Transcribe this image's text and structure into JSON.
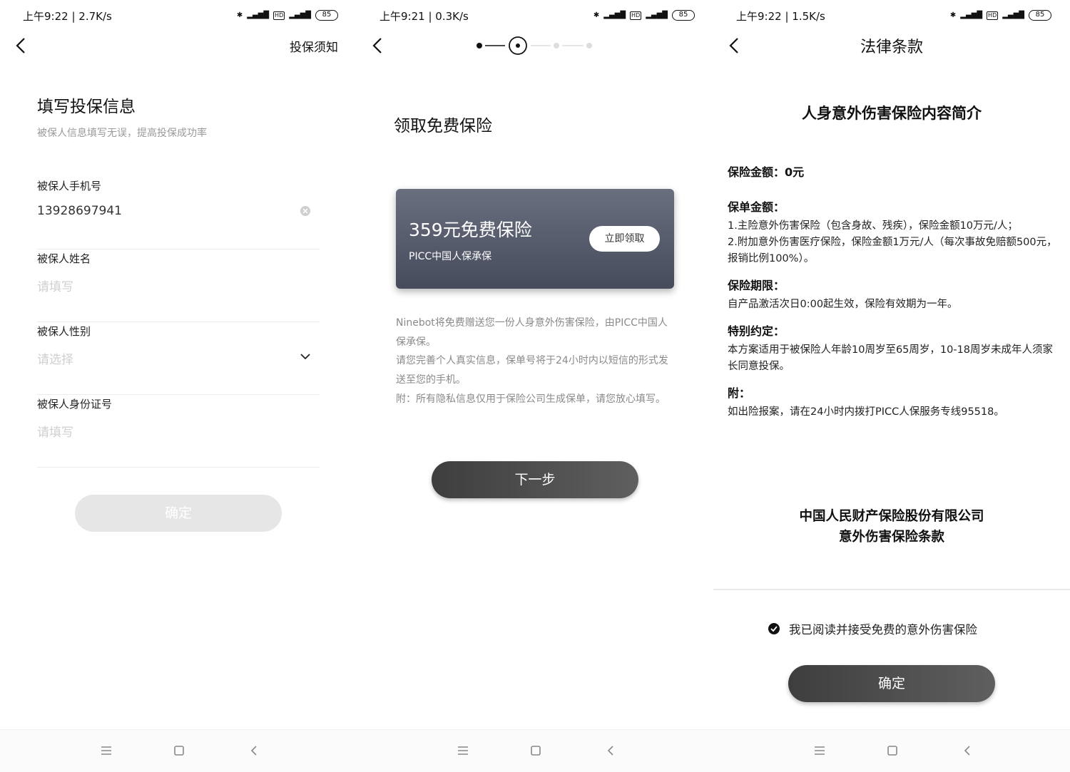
{
  "screen1": {
    "status": {
      "time": "上午9:22 | 2.7K/s",
      "battery": "85"
    },
    "notice_link": "投保须知",
    "title": "填写投保信息",
    "subtitle": "被保人信息填写无误，提高投保成功率",
    "fields": [
      {
        "label": "被保人手机号",
        "value": "13928697941"
      },
      {
        "label": "被保人姓名",
        "placeholder": "请填写"
      },
      {
        "label": "被保人性别",
        "placeholder": "请选择"
      },
      {
        "label": "被保人身份证号",
        "placeholder": "请填写"
      }
    ],
    "confirm": "确定"
  },
  "screen2": {
    "status": {
      "time": "上午9:21 | 0.3K/s",
      "battery": "85"
    },
    "title": "领取免费保险",
    "card": {
      "title": "359元免费保险",
      "subtitle": "PICC中国人保承保",
      "button": "立即领取"
    },
    "desc": [
      "Ninebot将免费赠送您一份人身意外伤害保险，由PICC中国人保承保。",
      "请您完善个人真实信息，保单号将于24小时内以短信的形式发送至您的手机。",
      "附：所有隐私信息仅用于保险公司生成保单，请您放心填写。"
    ],
    "next": "下一步"
  },
  "screen3": {
    "status": {
      "time": "上午9:22 | 1.5K/s",
      "battery": "85"
    },
    "nav_title": "法律条款",
    "doc_title": "人身意外伤害保险内容简介",
    "sections": [
      {
        "heading": "保险金额：0元",
        "lines": []
      },
      {
        "heading": "保单金额：",
        "lines": [
          "1.主险意外伤害保险（包含身故、残疾），保险金额10万元/人；",
          "2.附加意外伤害医疗保险，保险金额1万元/人（每次事故免赔额500元，报销比例100%）。"
        ]
      },
      {
        "heading": "保险期限：",
        "lines": [
          "自产品激活次日0:00起生效，保险有效期为一年。"
        ]
      },
      {
        "heading": "特别约定：",
        "lines": [
          "本方案适用于被保险人年龄10周岁至65周岁，10-18周岁未成年人须家长同意投保。"
        ]
      },
      {
        "heading": "附：",
        "lines": [
          "如出险报案，请在24小时内拨打PICC人保服务专线95518。"
        ]
      }
    ],
    "company_line1": "中国人民财产保险股份有限公司",
    "company_line2": "意外伤害保险条款",
    "agree_text": "我已阅读并接受免费的意外伤害保险",
    "confirm": "确定"
  }
}
